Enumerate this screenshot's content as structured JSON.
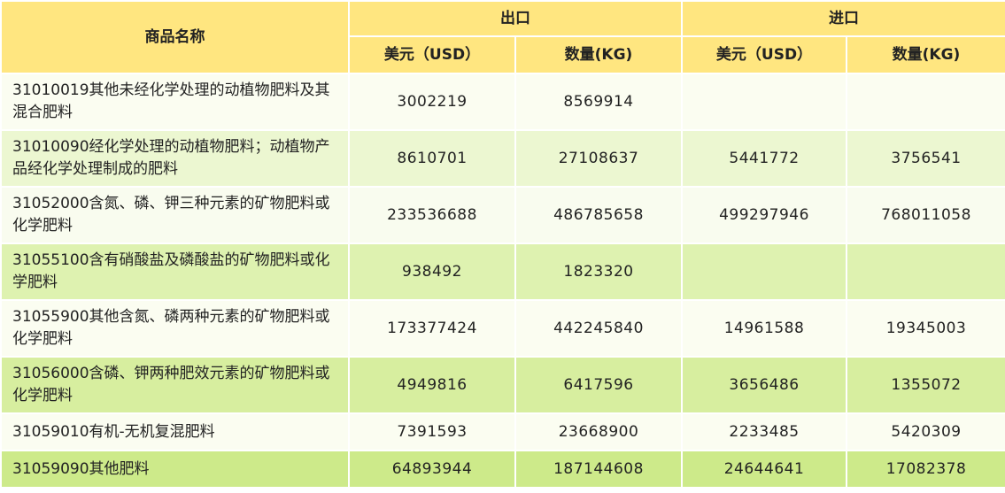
{
  "header": {
    "name_col": "商品名称",
    "export": "出口",
    "import": "进口",
    "usd": "美元（USD）",
    "kg": "数量(KG)"
  },
  "rows": [
    {
      "name": "31010019其他未经化学处理的动植物肥料及其混合肥料",
      "ex_usd": "3002219",
      "ex_kg": "8569914",
      "im_usd": "",
      "im_kg": ""
    },
    {
      "name": "31010090经化学处理的动植物肥料；动植物产品经化学处理制成的肥料",
      "ex_usd": "8610701",
      "ex_kg": "27108637",
      "im_usd": "5441772",
      "im_kg": "3756541"
    },
    {
      "name": "31052000含氮、磷、钾三种元素的矿物肥料或化学肥料",
      "ex_usd": "233536688",
      "ex_kg": "486785658",
      "im_usd": "499297946",
      "im_kg": "768011058"
    },
    {
      "name": "31055100含有硝酸盐及磷酸盐的矿物肥料或化学肥料",
      "ex_usd": "938492",
      "ex_kg": "1823320",
      "im_usd": "",
      "im_kg": ""
    },
    {
      "name": "31055900其他含氮、磷两种元素的矿物肥料或化学肥料",
      "ex_usd": "173377424",
      "ex_kg": "442245840",
      "im_usd": "14961588",
      "im_kg": "19345003"
    },
    {
      "name": "31056000含磷、钾两种肥效元素的矿物肥料或化学肥料",
      "ex_usd": "4949816",
      "ex_kg": "6417596",
      "im_usd": "3656486",
      "im_kg": "1355072"
    },
    {
      "name": "31059010有机-无机复混肥料",
      "ex_usd": "7391593",
      "ex_kg": "23668900",
      "im_usd": "2233485",
      "im_kg": "5420309"
    },
    {
      "name": "31059090其他肥料",
      "ex_usd": "64893944",
      "ex_kg": "187144608",
      "im_usd": "24644641",
      "im_kg": "17082378"
    }
  ]
}
